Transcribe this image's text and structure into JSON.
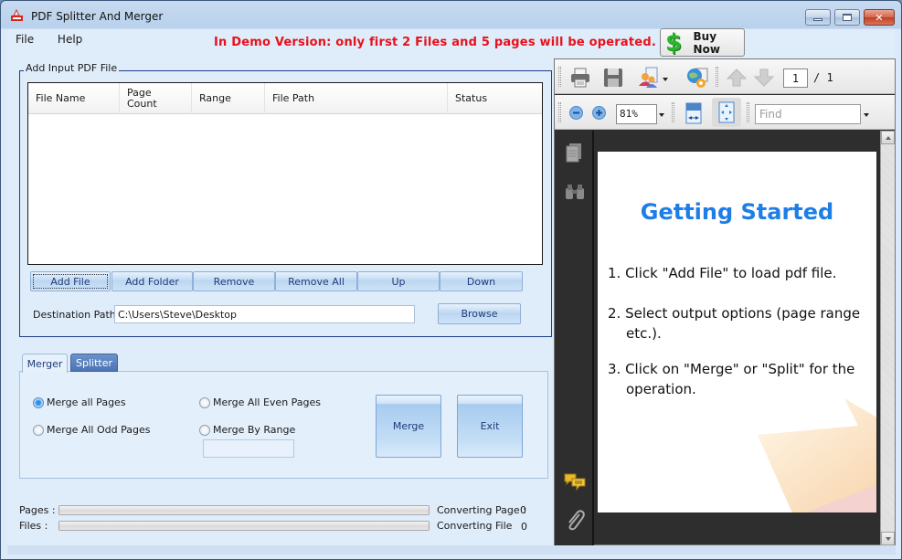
{
  "window": {
    "title": "PDF Splitter And Merger",
    "icon": "pdf-app-icon",
    "controls": [
      "minimize",
      "maximize",
      "close"
    ]
  },
  "menu": {
    "items": [
      {
        "label": "File"
      },
      {
        "label": "Help"
      }
    ]
  },
  "demo_notice": "In Demo Version: only first 2 Files and 5 pages will be operated.",
  "buy_now": {
    "label": "Buy Now",
    "icon": "dollar-icon"
  },
  "input_group": {
    "title": "Add Input PDF File",
    "table": {
      "columns": [
        {
          "label": "File Name"
        },
        {
          "label": "Page\nCount"
        },
        {
          "label": "Range"
        },
        {
          "label": "File Path"
        },
        {
          "label": "Status"
        }
      ],
      "rows": []
    },
    "buttons": [
      {
        "label": "Add File"
      },
      {
        "label": "Add Folder"
      },
      {
        "label": "Remove"
      },
      {
        "label": "Remove All"
      },
      {
        "label": "Up"
      },
      {
        "label": "Down"
      }
    ],
    "destination": {
      "label": "Destination Path:",
      "value": "C:\\Users\\Steve\\Desktop",
      "browse_label": "Browse"
    }
  },
  "tabs": [
    {
      "label": "Merger",
      "active": true
    },
    {
      "label": "Splitter",
      "active": false
    }
  ],
  "merger": {
    "options": [
      {
        "label": "Merge all Pages",
        "checked": true
      },
      {
        "label": "Merge All Odd Pages",
        "checked": false
      },
      {
        "label": "Merge All Even Pages",
        "checked": false
      },
      {
        "label": "Merge By Range",
        "checked": false
      }
    ],
    "range_value": "",
    "merge_label": "Merge",
    "exit_label": "Exit"
  },
  "progress": {
    "pages_label": "Pages :",
    "files_label": "Files :",
    "pages_progress": 0,
    "files_progress": 0,
    "converting_page_label": "Converting Page :",
    "converting_page_value": "0",
    "converting_file_label": "Converting File",
    "converting_file_value": "0"
  },
  "viewer": {
    "toolbar1": {
      "icons": [
        "print-icon",
        "save-icon",
        "share-icon",
        "web-settings-icon",
        "prev-page-icon",
        "next-page-icon"
      ],
      "current_page": "1",
      "total_pages": "/ 1"
    },
    "toolbar2": {
      "icons": [
        "zoom-out-icon",
        "zoom-in-icon",
        "fit-width-icon",
        "fit-page-icon"
      ],
      "zoom": "81%",
      "find_placeholder": "Find"
    },
    "sidebar_icons": [
      "pages-icon",
      "binoculars-icon",
      "comments-icon",
      "attachment-icon"
    ],
    "document": {
      "heading": "Getting Started",
      "steps": [
        "1. Click \"Add File\" to load pdf file.",
        "2. Select output options (page range etc.).",
        "3. Click on \"Merge\" or \"Split\" for the operation."
      ]
    }
  },
  "colors": {
    "demo_text": "#e8101a",
    "heading_blue": "#1e7ee6",
    "group_border": "#1f3d8a",
    "tab_inactive": "#4d74b3"
  }
}
